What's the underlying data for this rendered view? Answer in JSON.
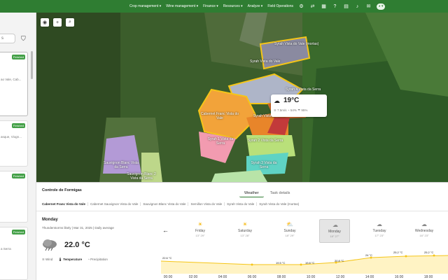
{
  "topbar": {
    "nav": [
      "Crop management ▾",
      "Wine management ▾",
      "Finance ▾",
      "Resources ▾",
      "Analyze ▾",
      "Field Operations"
    ],
    "icons": [
      "gear-icon",
      "sync-icon",
      "grid-icon",
      "help-icon",
      "news-icon",
      "bell-icon",
      "chat-icon"
    ],
    "avatar": "◕ ▾"
  },
  "sidebar": {
    "search_placeholder": "s",
    "badges": [
      "Finished",
      "Finished",
      "Finished",
      "Finished"
    ],
    "snippets": [
      "ao Vale, Cab...",
      "asque, Viogn...",
      "a Serra"
    ]
  },
  "map": {
    "labels": [
      "Syrah Vista do\nVale (mortas)",
      "Syrah Vista do Vale",
      "Syrah 4 Vista da Serra",
      "Cabernet Franc Vista do Vale",
      "Syrah Vista da Serra",
      "Syrah 1 Vista da Serra",
      "Syrah 2 Vista da Serra",
      "Sauvignon Blanc Vista da Serra",
      "Sauvignon Blanc 2 Vista da Serra",
      "Syrah 3 Vista da Serra",
      "Syrah 2 Vista da Serra",
      "Sauvignon Blanc 2 Vista da Serra"
    ],
    "popup": {
      "temp": "19°C",
      "wind": "7.5m/s",
      "humidity": "54%",
      "rain": "95%"
    }
  },
  "panel": {
    "title": "Controle de Formigas",
    "tabs": [
      "Weather",
      "Task details"
    ],
    "parcels": [
      "Cabernet Franc Vista do Vale",
      "Cabernet Sauvignon Vista do Vale",
      "Sauvignon Blanc Vista do Vale",
      "Semillon Vista do Vale",
      "Syrah Vista do Vale",
      "Syrah Vista do Vale (mortas)"
    ],
    "day": "Monday",
    "day_sub": "Thunderstorms likely  |  Mar 31, 2025  |  Daily average",
    "temp": "22.0 °C",
    "metrics": [
      "Wind",
      "Temperature",
      "Precipitation"
    ],
    "days": [
      {
        "name": "Friday",
        "temps": "13° 29°"
      },
      {
        "name": "Saturday",
        "temps": "13° 28°"
      },
      {
        "name": "Sunday",
        "temps": "18° 29°"
      },
      {
        "name": "Monday",
        "temps": "18° 27°"
      },
      {
        "name": "Tuesday",
        "temps": "17° 23°"
      },
      {
        "name": "Wednesday",
        "temps": "16° 23°"
      }
    ],
    "hours": [
      "00:00",
      "02:00",
      "04:00",
      "06:00",
      "08:00",
      "10:00",
      "12:00",
      "14:00",
      "16:00",
      "18:00"
    ],
    "point_labels": [
      "22.6 °C",
      "19.5 °C",
      "19.8 °C",
      "20.8 °C",
      "24 °C",
      "25.2 °C",
      "25.2 °C"
    ]
  },
  "colors": {
    "topbar": "#2f7d32",
    "badge": "#43a047",
    "chart_fill": "#fff3c4",
    "chart_line": "#f5c518"
  }
}
